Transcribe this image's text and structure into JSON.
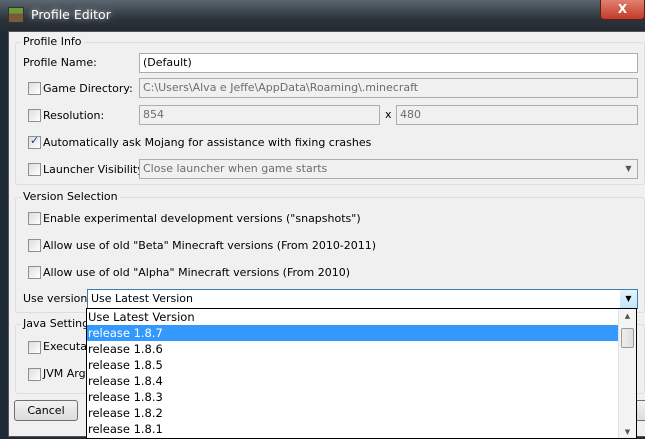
{
  "window": {
    "title": "Profile Editor",
    "close_label": "X"
  },
  "profile_info": {
    "label": "Profile Info",
    "name_label": "Profile Name:",
    "name_value": "(Default)",
    "game_dir_label": "Game Directory:",
    "game_dir_value": "C:\\Users\\Alva e Jeffe\\AppData\\Roaming\\.minecraft",
    "game_dir_checked": false,
    "resolution_label": "Resolution:",
    "res_width": "854",
    "res_x": "x",
    "res_height": "480",
    "resolution_checked": false,
    "auto_crash_label": "Automatically ask Mojang for assistance with fixing crashes",
    "auto_crash_checked": true,
    "launcher_vis_label": "Launcher Visibility:",
    "launcher_vis_value": "Close launcher when game starts",
    "launcher_vis_checked": false
  },
  "version_selection": {
    "label": "Version Selection",
    "snapshots_label": "Enable experimental development versions (\"snapshots\")",
    "beta_label": "Allow use of old \"Beta\" Minecraft versions (From 2010-2011)",
    "alpha_label": "Allow use of old \"Alpha\" Minecraft versions (From 2010)",
    "use_version_label": "Use version:",
    "use_version_value": "Use Latest Version",
    "options": [
      "Use Latest Version",
      "release 1.8.7",
      "release 1.8.6",
      "release 1.8.5",
      "release 1.8.4",
      "release 1.8.3",
      "release 1.8.2",
      "release 1.8.1"
    ],
    "highlighted_index": 1
  },
  "java_settings": {
    "label": "Java Settings",
    "executable_label": "Executable",
    "jvm_label": "JVM Arguments"
  },
  "buttons": {
    "cancel": "Cancel"
  }
}
